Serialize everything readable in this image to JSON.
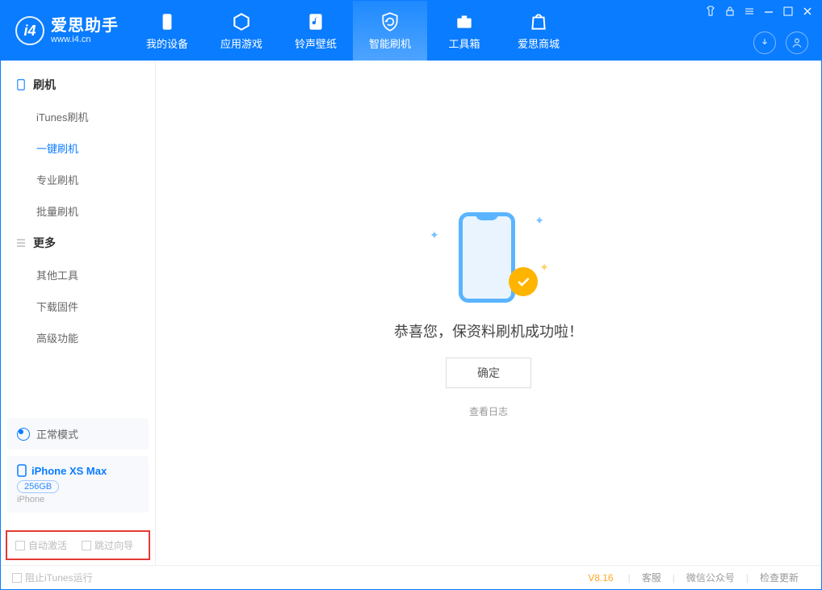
{
  "header": {
    "app_name": "爱思助手",
    "app_url": "www.i4.cn",
    "nav": [
      {
        "label": "我的设备"
      },
      {
        "label": "应用游戏"
      },
      {
        "label": "铃声壁纸"
      },
      {
        "label": "智能刷机"
      },
      {
        "label": "工具箱"
      },
      {
        "label": "爱思商城"
      }
    ]
  },
  "sidebar": {
    "group1": {
      "title": "刷机",
      "items": [
        "iTunes刷机",
        "一键刷机",
        "专业刷机",
        "批量刷机"
      ]
    },
    "group2": {
      "title": "更多",
      "items": [
        "其他工具",
        "下载固件",
        "高级功能"
      ]
    },
    "mode_label": "正常模式",
    "device": {
      "name": "iPhone XS Max",
      "capacity": "256GB",
      "type": "iPhone"
    },
    "checks": {
      "auto_activate": "自动激活",
      "skip_guide": "跳过向导"
    }
  },
  "main": {
    "success_text": "恭喜您，保资料刷机成功啦！",
    "ok_button": "确定",
    "view_log": "查看日志"
  },
  "footer": {
    "block_itunes": "阻止iTunes运行",
    "version": "V8.16",
    "links": [
      "客服",
      "微信公众号",
      "检查更新"
    ]
  }
}
